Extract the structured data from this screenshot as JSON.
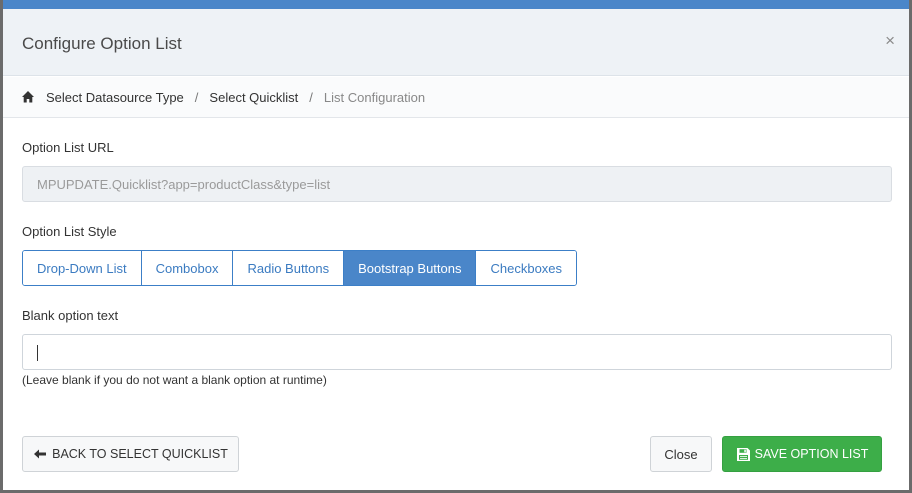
{
  "modal": {
    "title": "Configure Option List",
    "close_glyph": "×"
  },
  "breadcrumb": {
    "home_icon": "home-icon",
    "items": [
      {
        "label": "Select Datasource Type"
      },
      {
        "label": "Select Quicklist"
      },
      {
        "label": "List Configuration"
      }
    ],
    "separator": "/"
  },
  "url_field": {
    "label": "Option List URL",
    "value": "MPUPDATE.Quicklist?app=productClass&type=list"
  },
  "style": {
    "label": "Option List Style",
    "options": [
      {
        "label": "Drop-Down List"
      },
      {
        "label": "Combobox"
      },
      {
        "label": "Radio Buttons"
      },
      {
        "label": "Bootstrap Buttons"
      },
      {
        "label": "Checkboxes"
      }
    ],
    "selected": "Bootstrap Buttons"
  },
  "blank_option": {
    "label": "Blank option text",
    "value": "",
    "hint": "(Leave blank if you do not want a blank option at runtime)"
  },
  "footer": {
    "back_label": "BACK TO SELECT QUICKLIST",
    "close_label": "Close",
    "save_label": "SAVE OPTION LIST"
  },
  "colors": {
    "accent": "#4a86c9",
    "save": "#3dae49"
  }
}
